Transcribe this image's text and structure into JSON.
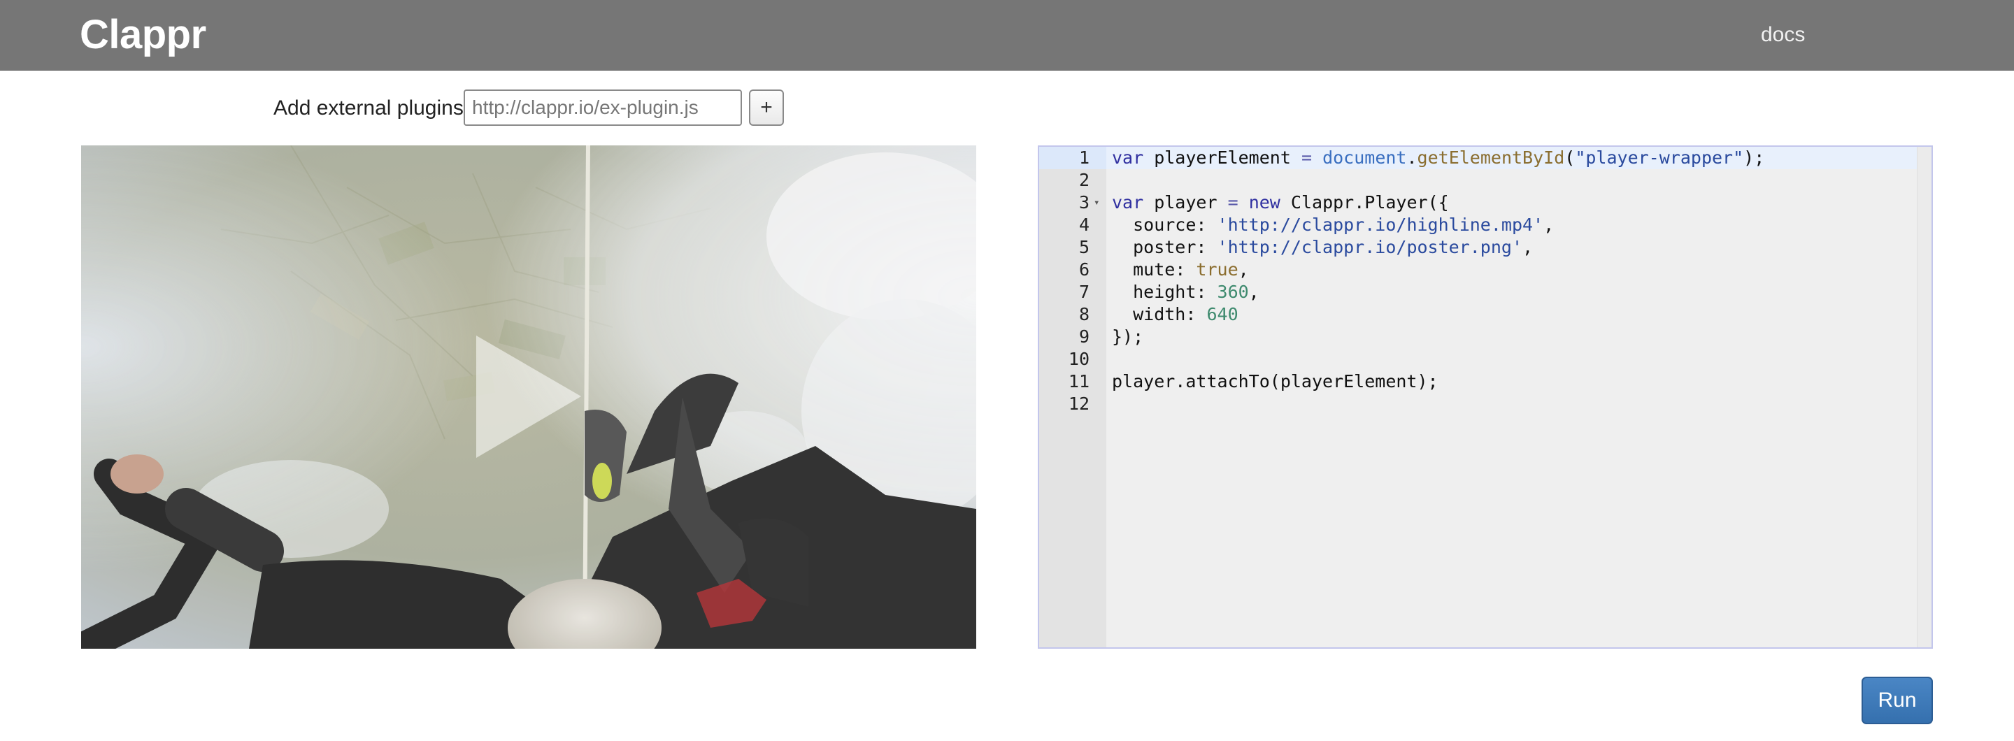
{
  "header": {
    "brand": "Clappr",
    "nav_docs": "docs"
  },
  "plugins": {
    "label": "Add external plugins:",
    "placeholder": "http://clappr.io/ex-plugin.js",
    "add_label": "+"
  },
  "player": {
    "poster": "skydiver-highline-aerial-poster",
    "play_icon": "play-icon"
  },
  "editor": {
    "active_line": 1,
    "lines": [
      {
        "n": "1",
        "fold": "",
        "tokens": [
          [
            "kw",
            "var"
          ],
          [
            "",
            "  playerElement "
          ],
          [
            "op",
            "="
          ],
          [
            "",
            ""
          ],
          [
            "glb",
            " document"
          ],
          [
            "",
            ""
          ],
          [
            "",
            ""
          ]
        ]
      },
      {
        "n": "2",
        "fold": "",
        "tokens": []
      },
      {
        "n": "3",
        "fold": "▾",
        "tokens": []
      },
      {
        "n": "4",
        "fold": "",
        "tokens": []
      },
      {
        "n": "5",
        "fold": "",
        "tokens": []
      },
      {
        "n": "6",
        "fold": "",
        "tokens": []
      },
      {
        "n": "7",
        "fold": "",
        "tokens": []
      },
      {
        "n": "8",
        "fold": "",
        "tokens": []
      },
      {
        "n": "9",
        "fold": "",
        "tokens": []
      },
      {
        "n": "10",
        "fold": "",
        "tokens": []
      },
      {
        "n": "11",
        "fold": "",
        "tokens": []
      },
      {
        "n": "12",
        "fold": "",
        "tokens": []
      }
    ],
    "code": [
      [
        [
          "kw",
          "var"
        ],
        [
          "",
          " playerElement "
        ],
        [
          "op",
          "="
        ],
        [
          "",
          " "
        ],
        [
          "glb",
          "document"
        ],
        [
          "",
          "."
        ],
        [
          "fn",
          "getElementById"
        ],
        [
          "",
          "("
        ],
        [
          "str",
          "\"player-wrapper\""
        ],
        [
          "",
          ");"
        ]
      ],
      [],
      [
        [
          "kw",
          "var"
        ],
        [
          "",
          " player "
        ],
        [
          "op",
          "="
        ],
        [
          "",
          " "
        ],
        [
          "kw",
          "new"
        ],
        [
          "",
          " Clappr.Player({"
        ]
      ],
      [
        [
          "",
          "  source: "
        ],
        [
          "str",
          "'http://clappr.io/highline.mp4'"
        ],
        [
          "",
          ","
        ]
      ],
      [
        [
          "",
          "  poster: "
        ],
        [
          "str",
          "'http://clappr.io/poster.png'"
        ],
        [
          "",
          ","
        ]
      ],
      [
        [
          "",
          "  mute: "
        ],
        [
          "bool",
          "true"
        ],
        [
          "",
          ","
        ]
      ],
      [
        [
          "",
          "  height: "
        ],
        [
          "num",
          "360"
        ],
        [
          "",
          ","
        ]
      ],
      [
        [
          "",
          "  width: "
        ],
        [
          "num",
          "640"
        ]
      ],
      [
        [
          "",
          "});"
        ]
      ],
      [],
      [
        [
          "",
          "player.attachTo(playerElement);"
        ]
      ],
      []
    ]
  },
  "run": {
    "label": "Run"
  }
}
